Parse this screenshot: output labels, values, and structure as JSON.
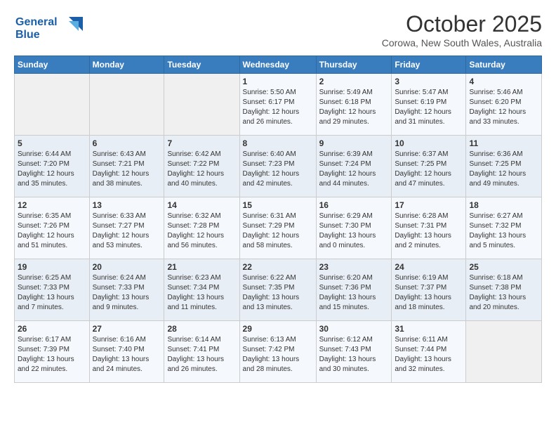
{
  "header": {
    "logo_line1": "General",
    "logo_line2": "Blue",
    "month": "October 2025",
    "location": "Corowa, New South Wales, Australia"
  },
  "weekdays": [
    "Sunday",
    "Monday",
    "Tuesday",
    "Wednesday",
    "Thursday",
    "Friday",
    "Saturday"
  ],
  "weeks": [
    [
      {
        "day": "",
        "info": ""
      },
      {
        "day": "",
        "info": ""
      },
      {
        "day": "",
        "info": ""
      },
      {
        "day": "1",
        "info": "Sunrise: 5:50 AM\nSunset: 6:17 PM\nDaylight: 12 hours\nand 26 minutes."
      },
      {
        "day": "2",
        "info": "Sunrise: 5:49 AM\nSunset: 6:18 PM\nDaylight: 12 hours\nand 29 minutes."
      },
      {
        "day": "3",
        "info": "Sunrise: 5:47 AM\nSunset: 6:19 PM\nDaylight: 12 hours\nand 31 minutes."
      },
      {
        "day": "4",
        "info": "Sunrise: 5:46 AM\nSunset: 6:20 PM\nDaylight: 12 hours\nand 33 minutes."
      }
    ],
    [
      {
        "day": "5",
        "info": "Sunrise: 6:44 AM\nSunset: 7:20 PM\nDaylight: 12 hours\nand 35 minutes."
      },
      {
        "day": "6",
        "info": "Sunrise: 6:43 AM\nSunset: 7:21 PM\nDaylight: 12 hours\nand 38 minutes."
      },
      {
        "day": "7",
        "info": "Sunrise: 6:42 AM\nSunset: 7:22 PM\nDaylight: 12 hours\nand 40 minutes."
      },
      {
        "day": "8",
        "info": "Sunrise: 6:40 AM\nSunset: 7:23 PM\nDaylight: 12 hours\nand 42 minutes."
      },
      {
        "day": "9",
        "info": "Sunrise: 6:39 AM\nSunset: 7:24 PM\nDaylight: 12 hours\nand 44 minutes."
      },
      {
        "day": "10",
        "info": "Sunrise: 6:37 AM\nSunset: 7:25 PM\nDaylight: 12 hours\nand 47 minutes."
      },
      {
        "day": "11",
        "info": "Sunrise: 6:36 AM\nSunset: 7:25 PM\nDaylight: 12 hours\nand 49 minutes."
      }
    ],
    [
      {
        "day": "12",
        "info": "Sunrise: 6:35 AM\nSunset: 7:26 PM\nDaylight: 12 hours\nand 51 minutes."
      },
      {
        "day": "13",
        "info": "Sunrise: 6:33 AM\nSunset: 7:27 PM\nDaylight: 12 hours\nand 53 minutes."
      },
      {
        "day": "14",
        "info": "Sunrise: 6:32 AM\nSunset: 7:28 PM\nDaylight: 12 hours\nand 56 minutes."
      },
      {
        "day": "15",
        "info": "Sunrise: 6:31 AM\nSunset: 7:29 PM\nDaylight: 12 hours\nand 58 minutes."
      },
      {
        "day": "16",
        "info": "Sunrise: 6:29 AM\nSunset: 7:30 PM\nDaylight: 13 hours\nand 0 minutes."
      },
      {
        "day": "17",
        "info": "Sunrise: 6:28 AM\nSunset: 7:31 PM\nDaylight: 13 hours\nand 2 minutes."
      },
      {
        "day": "18",
        "info": "Sunrise: 6:27 AM\nSunset: 7:32 PM\nDaylight: 13 hours\nand 5 minutes."
      }
    ],
    [
      {
        "day": "19",
        "info": "Sunrise: 6:25 AM\nSunset: 7:33 PM\nDaylight: 13 hours\nand 7 minutes."
      },
      {
        "day": "20",
        "info": "Sunrise: 6:24 AM\nSunset: 7:33 PM\nDaylight: 13 hours\nand 9 minutes."
      },
      {
        "day": "21",
        "info": "Sunrise: 6:23 AM\nSunset: 7:34 PM\nDaylight: 13 hours\nand 11 minutes."
      },
      {
        "day": "22",
        "info": "Sunrise: 6:22 AM\nSunset: 7:35 PM\nDaylight: 13 hours\nand 13 minutes."
      },
      {
        "day": "23",
        "info": "Sunrise: 6:20 AM\nSunset: 7:36 PM\nDaylight: 13 hours\nand 15 minutes."
      },
      {
        "day": "24",
        "info": "Sunrise: 6:19 AM\nSunset: 7:37 PM\nDaylight: 13 hours\nand 18 minutes."
      },
      {
        "day": "25",
        "info": "Sunrise: 6:18 AM\nSunset: 7:38 PM\nDaylight: 13 hours\nand 20 minutes."
      }
    ],
    [
      {
        "day": "26",
        "info": "Sunrise: 6:17 AM\nSunset: 7:39 PM\nDaylight: 13 hours\nand 22 minutes."
      },
      {
        "day": "27",
        "info": "Sunrise: 6:16 AM\nSunset: 7:40 PM\nDaylight: 13 hours\nand 24 minutes."
      },
      {
        "day": "28",
        "info": "Sunrise: 6:14 AM\nSunset: 7:41 PM\nDaylight: 13 hours\nand 26 minutes."
      },
      {
        "day": "29",
        "info": "Sunrise: 6:13 AM\nSunset: 7:42 PM\nDaylight: 13 hours\nand 28 minutes."
      },
      {
        "day": "30",
        "info": "Sunrise: 6:12 AM\nSunset: 7:43 PM\nDaylight: 13 hours\nand 30 minutes."
      },
      {
        "day": "31",
        "info": "Sunrise: 6:11 AM\nSunset: 7:44 PM\nDaylight: 13 hours\nand 32 minutes."
      },
      {
        "day": "",
        "info": ""
      }
    ]
  ]
}
